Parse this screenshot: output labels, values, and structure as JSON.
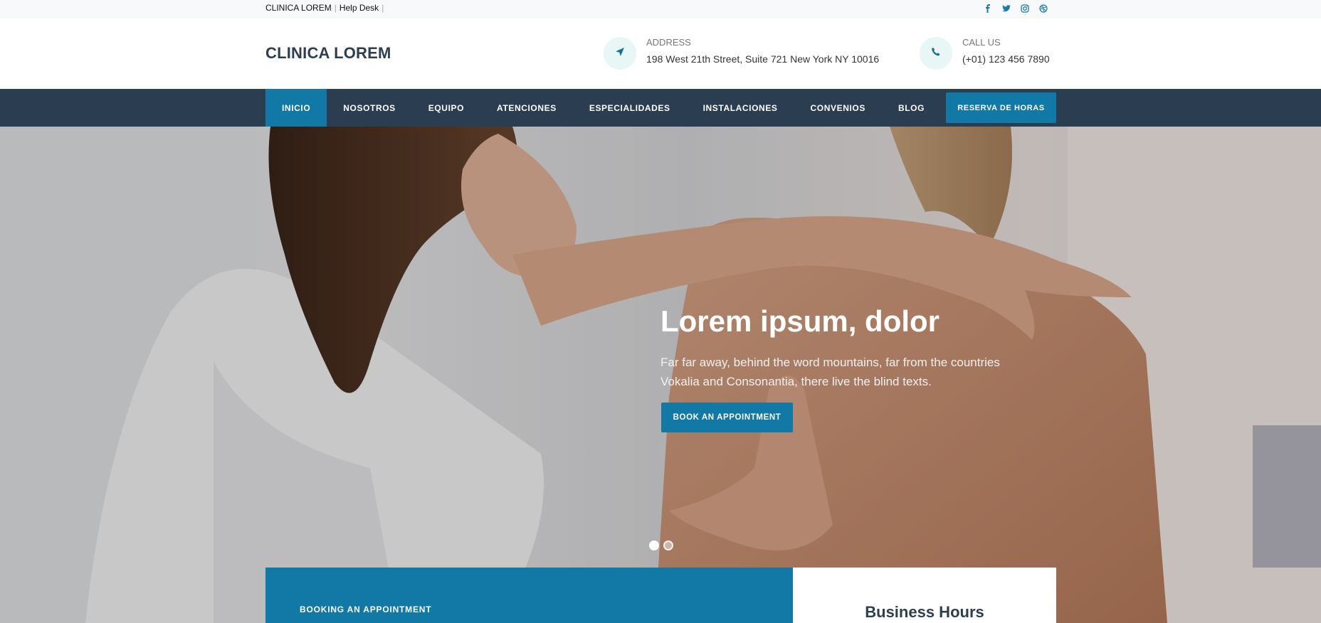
{
  "topbar": {
    "site_name": "CLINICA LOREM",
    "help_desk": "Help Desk",
    "separator": "|",
    "social": [
      {
        "icon": "facebook-icon",
        "glyph": "f"
      },
      {
        "icon": "twitter-icon",
        "glyph": ""
      },
      {
        "icon": "instagram-icon",
        "glyph": ""
      },
      {
        "icon": "dribbble-icon",
        "glyph": ""
      }
    ]
  },
  "header": {
    "logo": "CLINICA LOREM",
    "address": {
      "label": "ADDRESS",
      "value": "198 West 21th Street, Suite 721 New York NY 10016",
      "icon": "navigation-arrow-icon"
    },
    "call": {
      "label": "CALL US",
      "value": "(+01) 123 456 7890",
      "icon": "phone-icon"
    }
  },
  "nav": {
    "items": [
      {
        "label": "INICIO",
        "active": true
      },
      {
        "label": "NOSOTROS"
      },
      {
        "label": "EQUIPO"
      },
      {
        "label": "ATENCIONES"
      },
      {
        "label": "ESPECIALIDADES"
      },
      {
        "label": "INSTALACIONES"
      },
      {
        "label": "CONVENIOS"
      },
      {
        "label": "BLOG"
      }
    ],
    "cta": "RESERVA DE HORAS"
  },
  "hero": {
    "title": "Lorem ipsum, dolor",
    "text": "Far far away, behind the word mountains, far from the countries Vokalia and Consonantia, there live the blind texts.",
    "button": "BOOK AN APPOINTMENT",
    "slides": 2,
    "active_slide": 1
  },
  "booking": {
    "title": "BOOKING AN APPOINTMENT"
  },
  "hours": {
    "title": "Business Hours"
  },
  "colors": {
    "primary": "#1278a6",
    "nav_bg": "#2b3d50",
    "logo": "#2d3e50",
    "icon_circle": "#e8f6f6"
  }
}
